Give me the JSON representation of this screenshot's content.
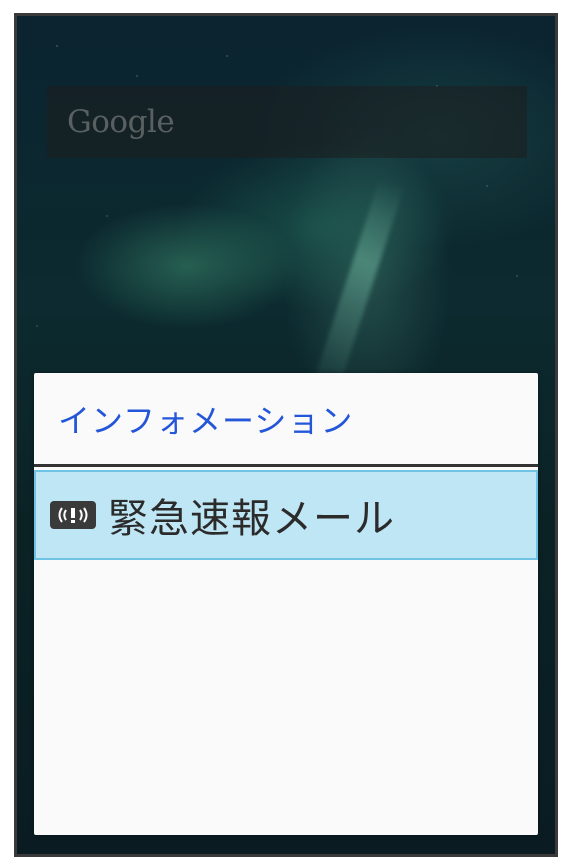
{
  "home": {
    "search_logo": "Google"
  },
  "dialog": {
    "title": "インフォメーション",
    "items": [
      {
        "label": "緊急速報メール",
        "icon": "emergency-alert-icon",
        "selected": true
      }
    ]
  },
  "colors": {
    "title_text": "#2356d8",
    "selected_bg": "#bfe6f4",
    "selected_border": "#6fc4e6"
  }
}
